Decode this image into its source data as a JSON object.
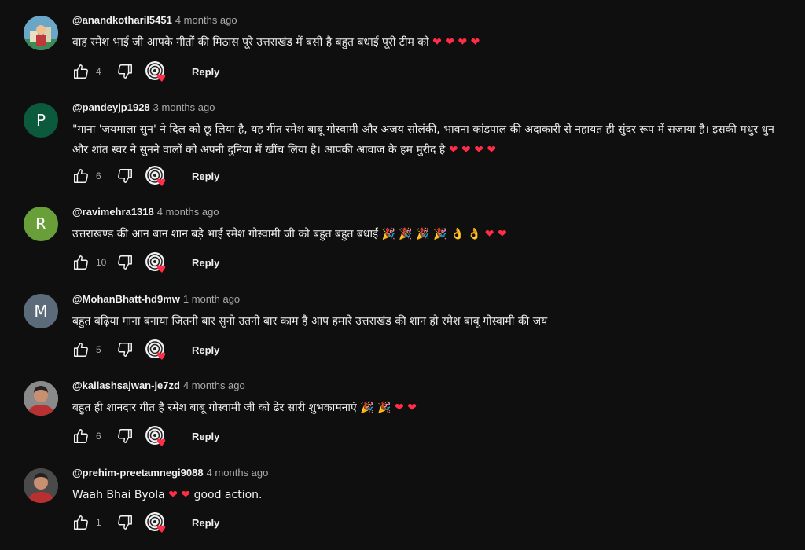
{
  "comments": [
    {
      "author": "@anandkotharil5451",
      "time": "4 months ago",
      "text": "वाह रमेश भाई जी आपके गीतों की मिठास पूरे उत्तराखंड में बसी है बहुत बधाई पूरी टीम को ❤️ ❤️ ❤️ ❤️",
      "likes": "4",
      "avatar": {
        "letter": "",
        "bg": "#6aa6c8",
        "icon": "cartoon-avatar-icon"
      },
      "reply_label": "Reply"
    },
    {
      "author": "@pandeyjp1928",
      "time": "3 months ago",
      "text": "\"गाना 'जयमाला सुन' ने दिल को छू लिया है, यह गीत रमेश बाबू गोस्वामी और अजय सोलंकी, भावना कांडपाल की अदाकारी से नहायत ही सुंदर रूप में सजाया है। इसकी मधुर धुन और शांत स्वर ने सुनने वालों को अपनी दुनिया में खींच लिया है। आपकी आवाज के हम मुरीद है ❤️ ❤️ ❤️ ❤️",
      "likes": "6",
      "avatar": {
        "letter": "P",
        "bg": "#0b5a3e",
        "icon": ""
      },
      "reply_label": "Reply"
    },
    {
      "author": "@ravimehra1318",
      "time": "4 months ago",
      "text": "उत्तराखण्ड की आन बान शान बड़े भाई रमेश गोस्वामी जी को बहुत बहुत बधाई 🎉 🎉 🎉 🎉 👌 👌 ❤️ ❤️",
      "likes": "10",
      "avatar": {
        "letter": "R",
        "bg": "#689f38",
        "icon": ""
      },
      "reply_label": "Reply"
    },
    {
      "author": "@MohanBhatt-hd9mw",
      "time": "1 month ago",
      "text": "बहुत बढ़िया गाना बनाया जितनी बार सुनो उतनी बार काम है आप हमारे उत्तराखंड की शान हो रमेश बाबू गोस्वामी की जय",
      "likes": "5",
      "avatar": {
        "letter": "M",
        "bg": "#5c6b7a",
        "icon": ""
      },
      "reply_label": "Reply"
    },
    {
      "author": "@kailashsajwan-je7zd",
      "time": "4 months ago",
      "text": "बहुत ही शानदार गीत है रमेश बाबू गोस्वामी जी को ढेर सारी शुभकामनाएं 🎉 🎉 ❤️ ❤️",
      "likes": "6",
      "avatar": {
        "letter": "",
        "bg": "#8a8a8a",
        "icon": "person-photo-icon"
      },
      "reply_label": "Reply"
    },
    {
      "author": "@prehim-preetamnegi9088",
      "time": "4 months ago",
      "text": "Waah Bhai Byola ❤️ ❤️ good action.",
      "likes": "1",
      "avatar": {
        "letter": "",
        "bg": "#4a4a4a",
        "icon": "person-photo-icon"
      },
      "reply_label": "Reply"
    }
  ],
  "colors": {
    "heart": "#ff2d48",
    "background": "#0f0f0f",
    "secondary_text": "#aaaaaa"
  }
}
